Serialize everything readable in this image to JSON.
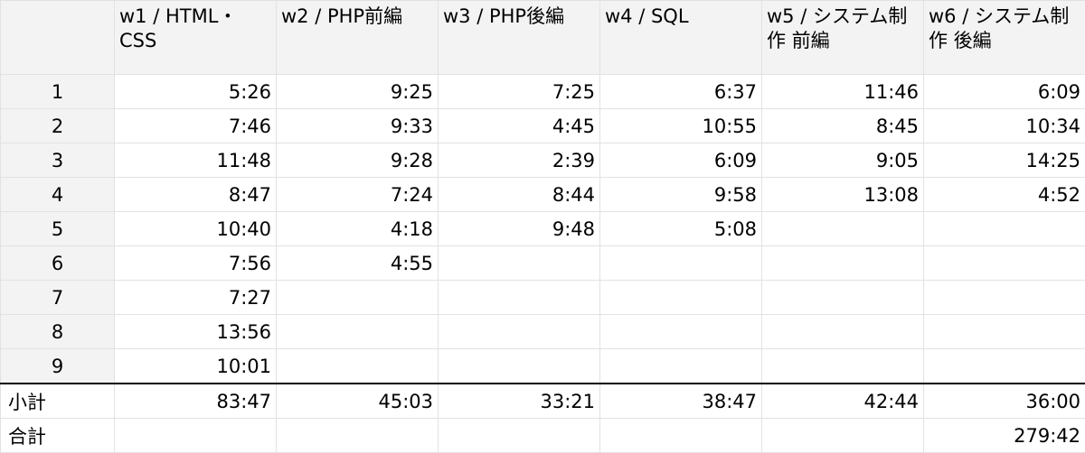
{
  "columns": [
    "w1 / HTML・CSS",
    "w2 / PHP前編",
    "w3 / PHP後編",
    "w4 / SQL",
    "w5 / システム制作 前編",
    "w6 / システム制作 後編"
  ],
  "rows": [
    {
      "label": "1",
      "cells": [
        "5:26",
        "9:25",
        "7:25",
        "6:37",
        "11:46",
        "6:09"
      ]
    },
    {
      "label": "2",
      "cells": [
        "7:46",
        "9:33",
        "4:45",
        "10:55",
        "8:45",
        "10:34"
      ]
    },
    {
      "label": "3",
      "cells": [
        "11:48",
        "9:28",
        "2:39",
        "6:09",
        "9:05",
        "14:25"
      ]
    },
    {
      "label": "4",
      "cells": [
        "8:47",
        "7:24",
        "8:44",
        "9:58",
        "13:08",
        "4:52"
      ]
    },
    {
      "label": "5",
      "cells": [
        "10:40",
        "4:18",
        "9:48",
        "5:08",
        "",
        ""
      ]
    },
    {
      "label": "6",
      "cells": [
        "7:56",
        "4:55",
        "",
        "",
        "",
        ""
      ]
    },
    {
      "label": "7",
      "cells": [
        "7:27",
        "",
        "",
        "",
        "",
        ""
      ]
    },
    {
      "label": "8",
      "cells": [
        "13:56",
        "",
        "",
        "",
        "",
        ""
      ]
    },
    {
      "label": "9",
      "cells": [
        "10:01",
        "",
        "",
        "",
        "",
        ""
      ]
    }
  ],
  "subtotal": {
    "label": "小計",
    "cells": [
      "83:47",
      "45:03",
      "33:21",
      "38:47",
      "42:44",
      "36:00"
    ]
  },
  "total": {
    "label": "合計",
    "cells": [
      "",
      "",
      "",
      "",
      "",
      "279:42"
    ]
  }
}
